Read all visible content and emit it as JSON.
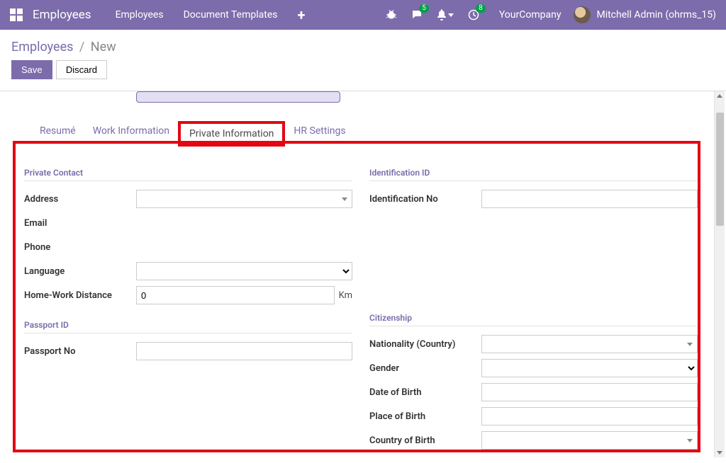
{
  "topbar": {
    "app_title": "Employees",
    "links": [
      "Employees",
      "Document Templates"
    ],
    "msg_badge": "5",
    "clock_badge": "8",
    "company": "YourCompany",
    "username": "Mitchell Admin (ohrms_15)"
  },
  "breadcrumb": {
    "root": "Employees",
    "current": "New"
  },
  "actions": {
    "save": "Save",
    "discard": "Discard"
  },
  "tabs": [
    "Resumé",
    "Work Information",
    "Private Information",
    "HR Settings"
  ],
  "active_tab": 2,
  "sections": {
    "private_contact": {
      "title": "Private Contact",
      "address_label": "Address",
      "email_label": "Email",
      "phone_label": "Phone",
      "language_label": "Language",
      "distance_label": "Home-Work Distance",
      "distance_value": "0",
      "distance_unit": "Km"
    },
    "passport": {
      "title": "Passport ID",
      "passport_no_label": "Passport No"
    },
    "identification": {
      "title": "Identification ID",
      "id_no_label": "Identification No"
    },
    "citizenship": {
      "title": "Citizenship",
      "nationality_label": "Nationality (Country)",
      "gender_label": "Gender",
      "dob_label": "Date of Birth",
      "pob_label": "Place of Birth",
      "cob_label": "Country of Birth"
    }
  }
}
